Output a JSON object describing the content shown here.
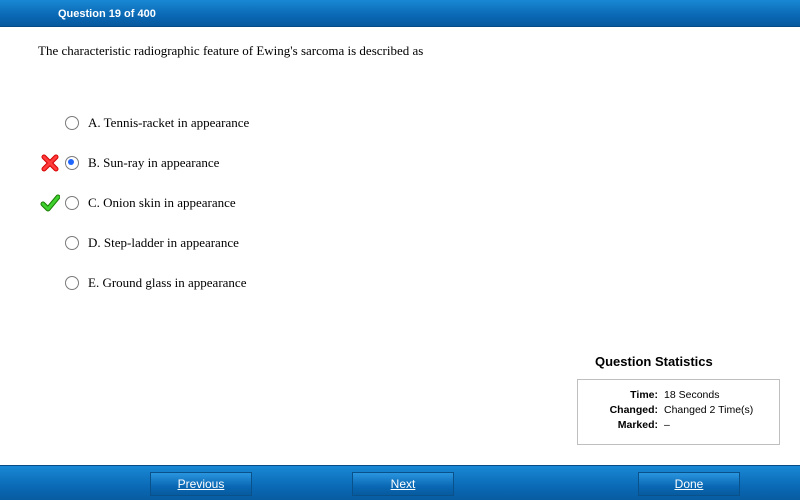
{
  "header": {
    "title": "Question 19 of 400"
  },
  "question": {
    "text": "The characteristic radiographic feature of Ewing's sarcoma is described as"
  },
  "options": [
    {
      "label": "A.  Tennis-racket in appearance",
      "selected": false,
      "mark": "none"
    },
    {
      "label": "B.  Sun-ray in appearance",
      "selected": true,
      "mark": "wrong"
    },
    {
      "label": "C.  Onion skin in appearance",
      "selected": false,
      "mark": "correct"
    },
    {
      "label": "D.  Step-ladder in appearance",
      "selected": false,
      "mark": "none"
    },
    {
      "label": "E.  Ground glass in appearance",
      "selected": false,
      "mark": "none"
    }
  ],
  "statistics": {
    "title": "Question Statistics",
    "time": {
      "label": "Time:",
      "value": "18 Seconds"
    },
    "changed": {
      "label": "Changed:",
      "value": "Changed 2 Time(s)"
    },
    "marked": {
      "label": "Marked:",
      "value": "–"
    }
  },
  "nav": {
    "previous": {
      "key": "P",
      "rest": "revious"
    },
    "next": {
      "key": "N",
      "rest": "ext"
    },
    "done": {
      "key": "D",
      "rest": "one"
    }
  }
}
